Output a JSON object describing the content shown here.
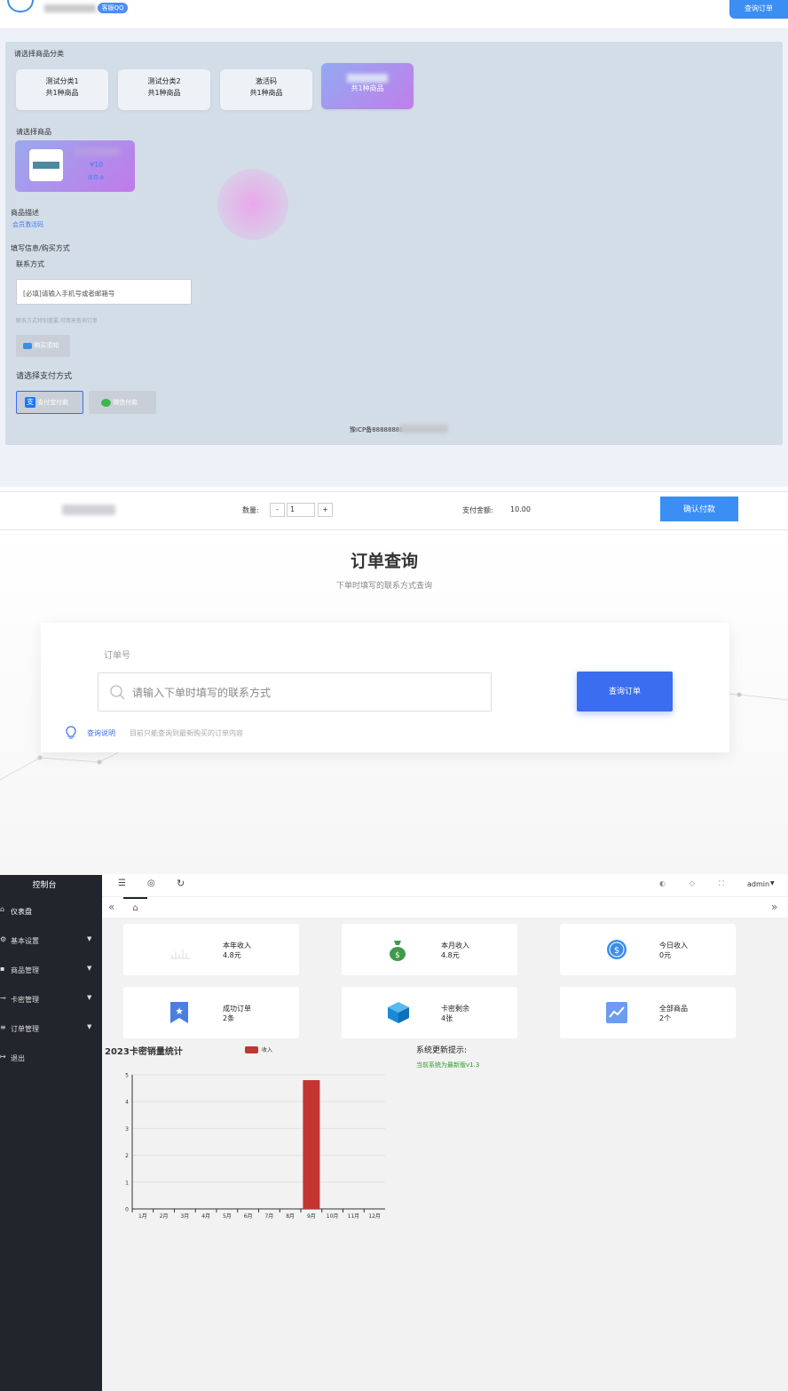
{
  "shop": {
    "topbar": {
      "qq_badge": "客服QQ",
      "query_button": "查询订单"
    },
    "category_title": "请选择商品分类",
    "categories": [
      {
        "name": "测试分类1",
        "count": "共1种商品"
      },
      {
        "name": "测试分类2",
        "count": "共1种商品"
      },
      {
        "name": "激活码",
        "count": "共1种商品"
      },
      {
        "name": "",
        "count": "共1种商品"
      }
    ],
    "product_title": "请选择商品",
    "product": {
      "price": "¥10",
      "stock": "库存:8"
    },
    "desc_title": "商品描述",
    "desc_text": "会员激活码",
    "fill_title": "填写信息/购买方式",
    "contact_label": "联系方式",
    "contact_placeholder": "[必填]请输入手机号或者邮箱号",
    "contact_hint": "联系方式特别重要,可用来查询订单",
    "notice_button": "购买须知",
    "pay_title": "请选择支付方式",
    "pay_alipay": "支付宝付款",
    "pay_wechat": "微信付款",
    "icp": "豫ICP备88888888"
  },
  "checkout": {
    "qty_label": "数量:",
    "qty_minus": "-",
    "qty_value": "1",
    "qty_plus": "+",
    "amount_label": "支付金额:",
    "amount_value": "10.00",
    "confirm_button": "确认付款"
  },
  "order_query": {
    "title": "订单查询",
    "subtitle": "下单时填写的联系方式查询",
    "field_label": "订单号",
    "placeholder": "请输入下单时填写的联系方式",
    "button": "查询订单",
    "hint_link": "查询说明",
    "hint_text": "目前只能查询到最新购买的订单内容"
  },
  "admin": {
    "brand": "控制台",
    "user": "admin",
    "menu": [
      "仪表盘",
      "基本设置",
      "商品管理",
      "卡密管理",
      "订单管理",
      "退出"
    ],
    "cards": [
      {
        "title": "本年收入",
        "value": "4.8元",
        "icon": "chart-icon"
      },
      {
        "title": "本月收入",
        "value": "4.8元",
        "icon": "money-bag-icon"
      },
      {
        "title": "今日收入",
        "value": "0元",
        "icon": "dollar-coin-icon"
      },
      {
        "title": "成功订单",
        "value": "2条",
        "icon": "star-badge-icon"
      },
      {
        "title": "卡密剩余",
        "value": "4张",
        "icon": "cube-icon"
      },
      {
        "title": "全部商品",
        "value": "2个",
        "icon": "trend-icon"
      }
    ],
    "update_title": "系统更新提示:",
    "update_text": "当前系统为最新版v1.3",
    "colors": {
      "accent": "#3a6df0",
      "bar": "#c23531",
      "sidebar": "#22252c"
    }
  },
  "chart_data": {
    "type": "bar",
    "title": "2023卡密销量统计",
    "categories": [
      "1月",
      "2月",
      "3月",
      "4月",
      "5月",
      "6月",
      "7月",
      "8月",
      "9月",
      "10月",
      "11月",
      "12月"
    ],
    "series": [
      {
        "name": "收入",
        "values": [
          0,
          0,
          0,
          0,
          0,
          0,
          0,
          0,
          4.8,
          0,
          0,
          0
        ]
      }
    ],
    "ylim": [
      0,
      5
    ],
    "yticks": [
      0,
      1,
      2,
      3,
      4,
      5
    ],
    "legend": "top",
    "grid": true
  }
}
